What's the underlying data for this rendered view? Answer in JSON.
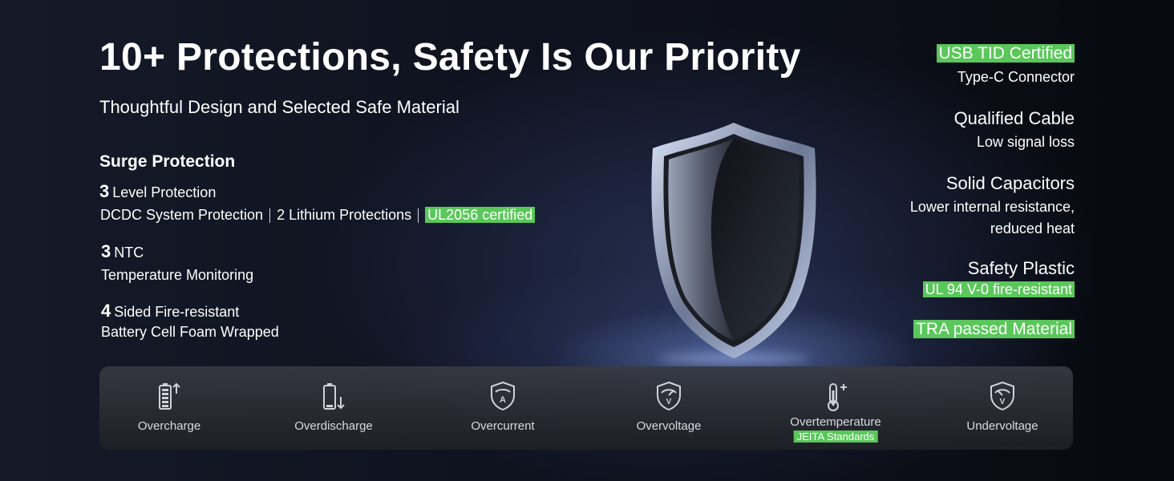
{
  "header": {
    "title": "10+ Protections, Safety Is Our Priority",
    "subtitle": "Thoughtful Design and Selected Safe Material"
  },
  "left": {
    "surge_heading": "Surge Protection",
    "level": {
      "num": "3",
      "text": "Level Protection"
    },
    "protections": [
      "DCDC System Protection",
      "2 Lithium Protections"
    ],
    "protection_badge": "UL2056 certified",
    "ntc": {
      "num": "3",
      "text": "NTC",
      "sub": "Temperature Monitoring"
    },
    "fire": {
      "num": "4",
      "text": "Sided Fire-resistant",
      "sub": "Battery Cell Foam Wrapped"
    }
  },
  "right": {
    "usb_badge": "USB TID Certified",
    "usb_sub": "Type-C Connector",
    "cable_head": "Qualified Cable",
    "cable_sub": "Low signal loss",
    "cap_head": "Solid Capacitors",
    "cap_sub1": "Lower internal resistance,",
    "cap_sub2": "reduced heat",
    "plastic_head": "Safety Plastic",
    "plastic_badge": "UL 94 V-0 fire-resistant",
    "tra_badge": "TRA passed Material"
  },
  "panel": {
    "items": [
      {
        "label": "Overcharge",
        "icon": "battery-up-icon"
      },
      {
        "label": "Overdischarge",
        "icon": "battery-down-icon"
      },
      {
        "label": "Overcurrent",
        "icon": "shield-a-icon"
      },
      {
        "label": "Overvoltage",
        "icon": "shield-gauge-v-icon"
      },
      {
        "label": "Overtemperature",
        "icon": "thermometer-plus-icon",
        "tag": "JEITA Standards"
      },
      {
        "label": "Undervoltage",
        "icon": "shield-gauge-v-icon"
      }
    ]
  },
  "colors": {
    "accent_green": "#5ac75a",
    "background": "#0f1320"
  }
}
